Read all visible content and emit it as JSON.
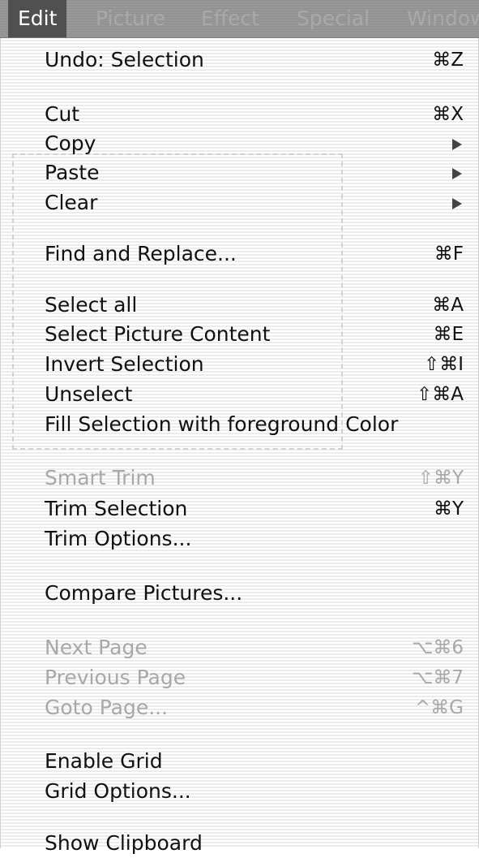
{
  "menubar": {
    "items": [
      {
        "label": "Edit",
        "active": true
      },
      {
        "label": "Picture"
      },
      {
        "label": "Effect"
      },
      {
        "label": "Special"
      },
      {
        "label": "Window"
      }
    ]
  },
  "menu": {
    "items": [
      {
        "label": "Undo: Selection",
        "shortcut": "⌘Z",
        "enabled": true
      },
      {
        "label": "Cut",
        "shortcut": "⌘X",
        "enabled": true
      },
      {
        "label": "Copy",
        "submenu": true,
        "enabled": true
      },
      {
        "label": "Paste",
        "submenu": true,
        "enabled": true
      },
      {
        "label": "Clear",
        "submenu": true,
        "enabled": true
      },
      {
        "label": "Find and Replace...",
        "shortcut": "⌘F",
        "enabled": true
      },
      {
        "label": "Select all",
        "shortcut": "⌘A",
        "enabled": true
      },
      {
        "label": "Select Picture Content",
        "shortcut": "⌘E",
        "enabled": true
      },
      {
        "label": "Invert Selection",
        "shortcut": "⇧⌘I",
        "enabled": true
      },
      {
        "label": "Unselect",
        "shortcut": "⇧⌘A",
        "enabled": true
      },
      {
        "label": "Fill Selection with foreground Color",
        "enabled": true
      },
      {
        "label": "Smart Trim",
        "shortcut": "⇧⌘Y",
        "enabled": false
      },
      {
        "label": "Trim Selection",
        "shortcut": "⌘Y",
        "enabled": true
      },
      {
        "label": "Trim Options...",
        "enabled": true
      },
      {
        "label": "Compare Pictures...",
        "enabled": true
      },
      {
        "label": "Next Page",
        "shortcut": "⌥⌘6",
        "enabled": false
      },
      {
        "label": "Previous Page",
        "shortcut": "⌥⌘7",
        "enabled": false
      },
      {
        "label": "Goto Page...",
        "shortcut": "^⌘G",
        "enabled": false
      },
      {
        "label": "Enable Grid",
        "enabled": true
      },
      {
        "label": "Grid Options...",
        "enabled": true
      },
      {
        "label": "Show Clipboard",
        "enabled": true
      }
    ]
  }
}
